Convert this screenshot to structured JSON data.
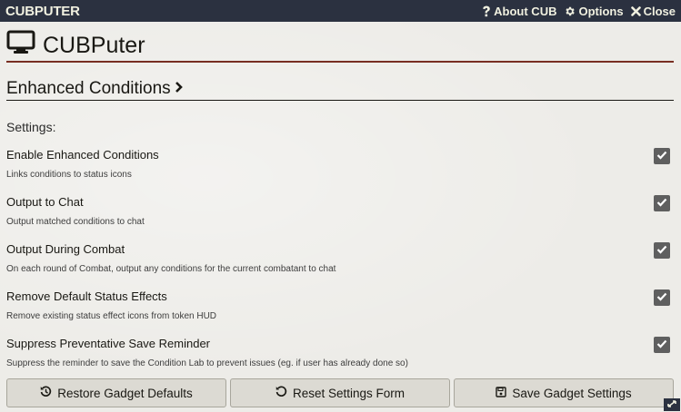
{
  "window": {
    "title": "CUBPUTER",
    "controls": [
      {
        "icon": "question-icon",
        "label": "About CUB"
      },
      {
        "icon": "gear-icon",
        "label": "Options"
      },
      {
        "icon": "close-icon",
        "label": "Close"
      }
    ]
  },
  "app": {
    "icon": "monitor-icon",
    "title": "CUBPuter"
  },
  "section": {
    "title": "Enhanced Conditions",
    "icon": "chevron-right-icon"
  },
  "settings_label": "Settings:",
  "settings": [
    {
      "label": "Enable Enhanced Conditions",
      "hint": "Links conditions to status icons",
      "checked": true
    },
    {
      "label": "Output to Chat",
      "hint": "Output matched conditions to chat",
      "checked": true
    },
    {
      "label": "Output During Combat",
      "hint": "On each round of Combat, output any conditions for the current combatant to chat",
      "checked": true
    },
    {
      "label": "Remove Default Status Effects",
      "hint": "Remove existing status effect icons from token HUD",
      "checked": true
    },
    {
      "label": "Suppress Preventative Save Reminder",
      "hint": "Suppress the reminder to save the Condition Lab to prevent issues (eg. if user has already done so)",
      "checked": true
    }
  ],
  "buttons": {
    "restore": "Restore Gadget Defaults",
    "reset": "Reset Settings Form",
    "save": "Save Gadget Settings"
  },
  "colors": {
    "header_bg": "#2b3140",
    "title_rule": "#782e22",
    "checkbox_bg": "#5f5f5f"
  }
}
